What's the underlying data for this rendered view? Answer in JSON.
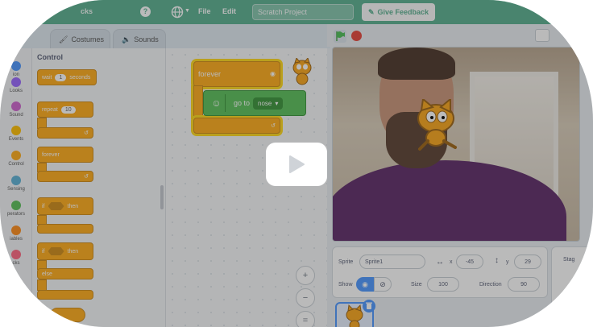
{
  "menu": {
    "title_tail": "cks",
    "help_label": "?",
    "file_label": "File",
    "edit_label": "Edit",
    "project_title": "Scratch Project",
    "feedback_label": "Give Feedback"
  },
  "tabs": {
    "costumes": "Costumes",
    "sounds": "Sounds"
  },
  "categories": [
    {
      "label": "ion",
      "color": "#4c97ff"
    },
    {
      "label": "Looks",
      "color": "#9966ff"
    },
    {
      "label": "Sound",
      "color": "#cf63cf"
    },
    {
      "label": "Events",
      "color": "#ffbf00"
    },
    {
      "label": "Control",
      "color": "#ffab19"
    },
    {
      "label": "Sensing",
      "color": "#5cb1d6"
    },
    {
      "label": "perators",
      "color": "#59c059"
    },
    {
      "label": "iables",
      "color": "#ff8c1a"
    },
    {
      "label": "cks",
      "color": "#ff6680"
    }
  ],
  "palette": {
    "title": "Control",
    "wait_label": "wait",
    "wait_value": "1",
    "wait_unit": "seconds",
    "repeat_label": "repeat",
    "repeat_value": "10",
    "forever_label": "forever",
    "if_label": "if",
    "then_label": "then",
    "else_label": "else"
  },
  "script": {
    "forever_label": "forever",
    "goto_label": "go to",
    "goto_target": "nose"
  },
  "zoom": {
    "in": "+",
    "out": "−",
    "reset": "="
  },
  "sprite": {
    "sprite_label": "Sprite",
    "sprite_name": "Sprite1",
    "x_label": "x",
    "x_value": "-45",
    "y_label": "y",
    "y_value": "29",
    "show_label": "Show",
    "size_label": "Size",
    "size_value": "100",
    "direction_label": "Direction",
    "direction_value": "90",
    "stage_label": "Stag"
  },
  "colors": {
    "menu_bar": "#59b090",
    "control_block": "#ffab19",
    "video_block": "#59c059",
    "stop": "#e6453a"
  }
}
